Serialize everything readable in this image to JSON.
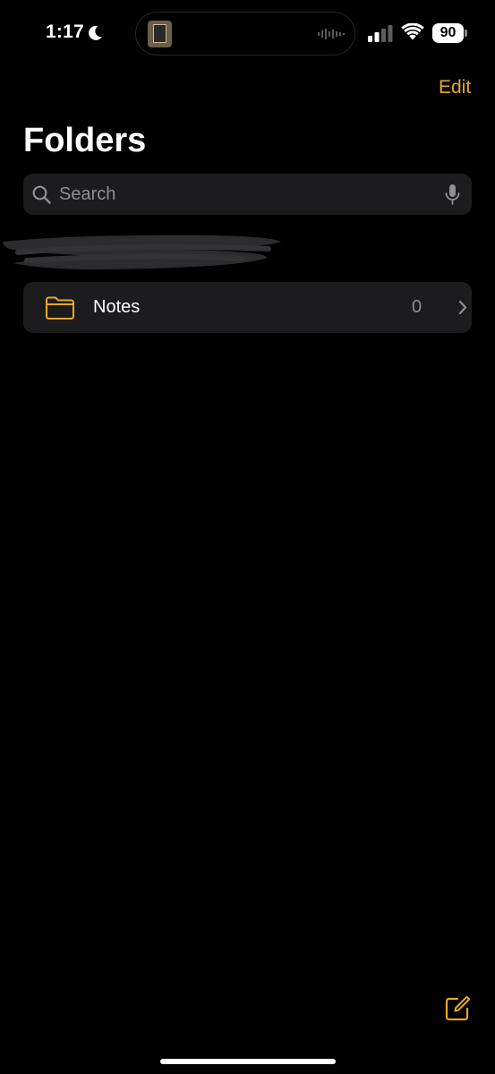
{
  "status_bar": {
    "time": "1:17",
    "focus_icon": "moon-icon",
    "battery_level": "90",
    "icons": [
      "moon-icon",
      "waveform-icon",
      "cellular-icon",
      "wifi-icon",
      "battery-icon"
    ],
    "cellular_bars_active": 2,
    "cellular_bars_total": 4
  },
  "header": {
    "edit_label": "Edit",
    "title": "Folders"
  },
  "search": {
    "placeholder": "Search",
    "value": "",
    "icons": [
      "search-icon",
      "mic-icon"
    ]
  },
  "folders": [
    {
      "name": "Notes",
      "count": "0",
      "icon": "folder-icon"
    }
  ],
  "toolbar": {
    "compose_icon": "compose-icon"
  },
  "colors": {
    "accent": "#e6a82b",
    "background": "#000000",
    "surface": "#1c1c1e",
    "secondary_text": "#8e8e93"
  }
}
